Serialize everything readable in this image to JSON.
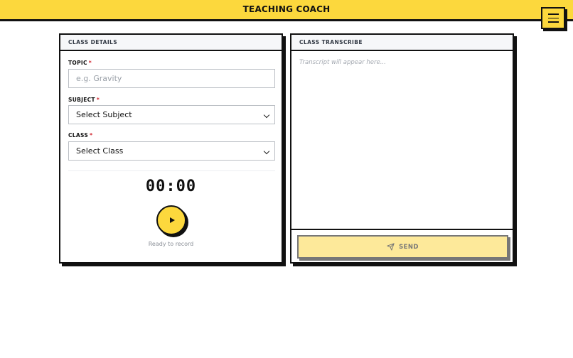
{
  "app": {
    "title": "TEACHING COACH"
  },
  "menu": {
    "icon": "hamburger-menu-icon"
  },
  "class_details": {
    "header": "CLASS DETAILS",
    "topic": {
      "label": "TOPIC",
      "required_mark": "*",
      "placeholder": "e.g. Gravity",
      "value": ""
    },
    "subject": {
      "label": "SUBJECT",
      "required_mark": "*",
      "selected": "Select Subject"
    },
    "class": {
      "label": "CLASS",
      "required_mark": "*",
      "selected": "Select Class"
    },
    "timer": "00:00",
    "record_button_icon": "play-icon",
    "status": "Ready to record"
  },
  "class_transcribe": {
    "header": "CLASS TRANSCRIBE",
    "placeholder": "Transcript will appear here...",
    "send_label": "SEND",
    "send_icon": "send-icon"
  },
  "colors": {
    "accent": "#fcd83d",
    "send_disabled_bg": "#fde99a",
    "required": "#d0202a"
  }
}
